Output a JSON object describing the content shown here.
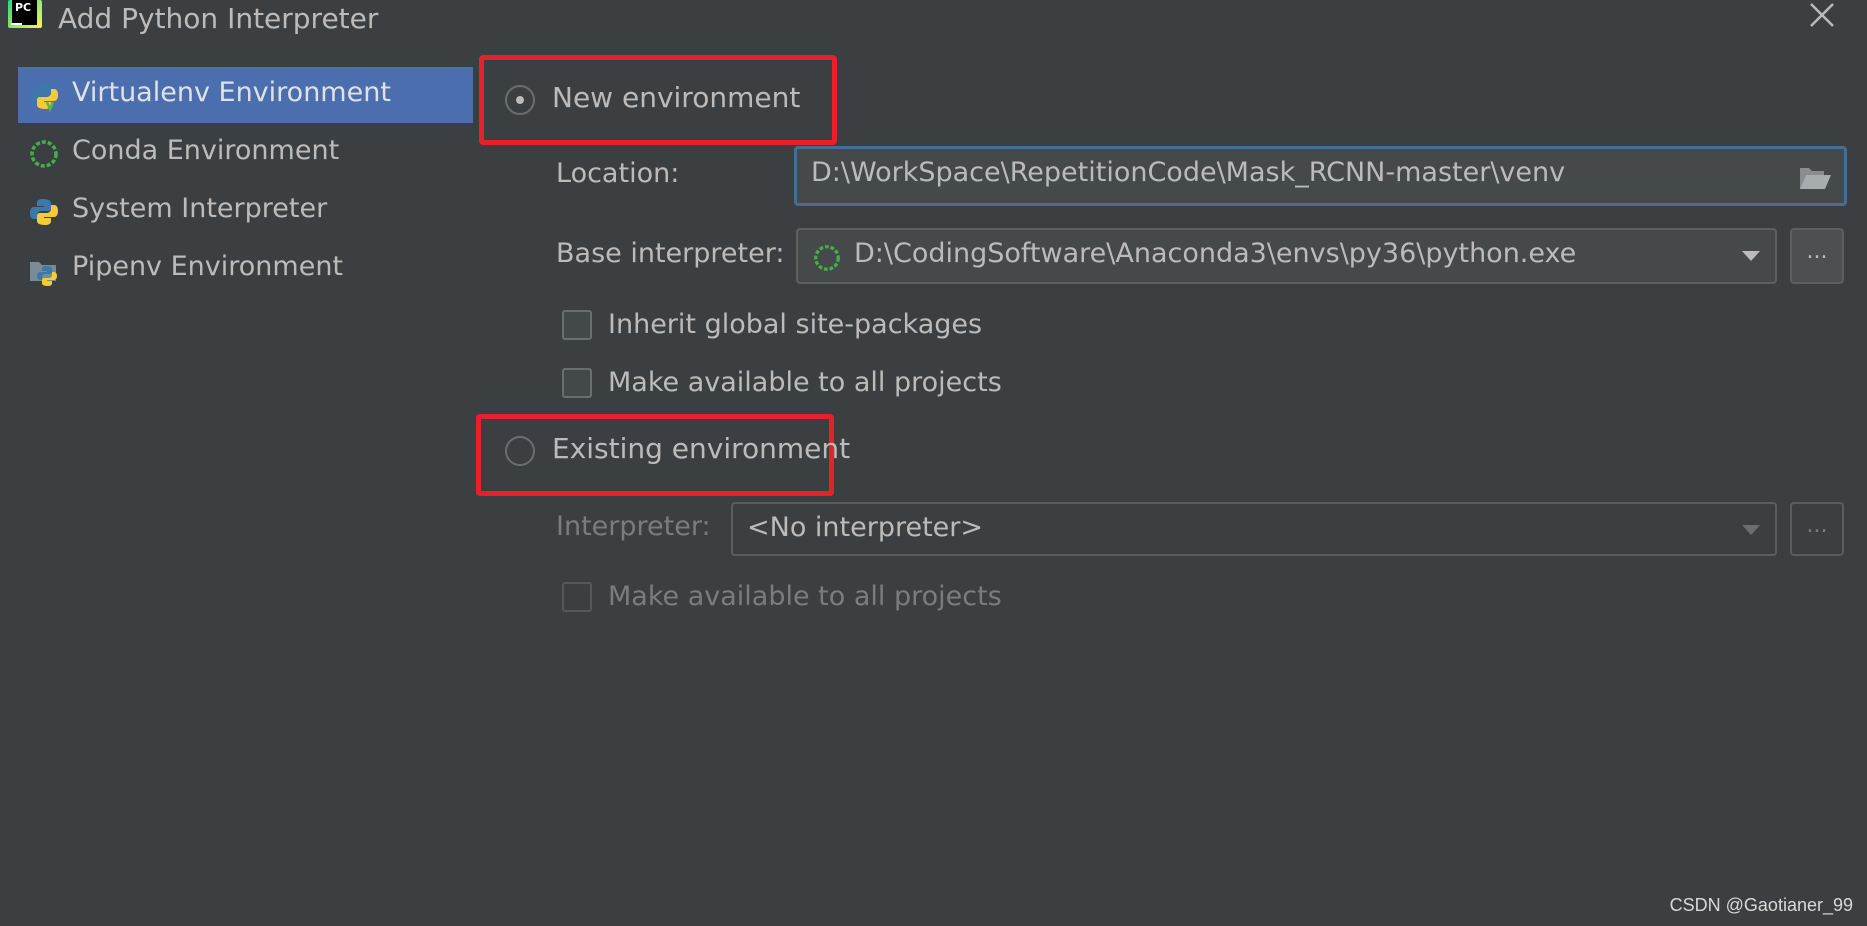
{
  "window": {
    "app_logo_text": "PC",
    "title": "Add Python Interpreter"
  },
  "sidebar": {
    "items": [
      {
        "label": "Virtualenv Environment",
        "icon": "python-venv-icon",
        "selected": true
      },
      {
        "label": "Conda Environment",
        "icon": "conda-icon",
        "selected": false
      },
      {
        "label": "System Interpreter",
        "icon": "python-icon",
        "selected": false
      },
      {
        "label": "Pipenv Environment",
        "icon": "pipenv-icon",
        "selected": false
      }
    ]
  },
  "new_env": {
    "label": "New environment",
    "selected": true,
    "location_label": "Location:",
    "location_value": "D:\\WorkSpace\\RepetitionCode\\Mask_RCNN-master\\venv",
    "base_label": "Base interpreter:",
    "base_value": "D:\\CodingSoftware\\Anaconda3\\envs\\py36\\python.exe",
    "browse_label": "...",
    "inherit_label": "Inherit global site-packages",
    "available_label": "Make available to all projects"
  },
  "existing_env": {
    "label": "Existing environment",
    "selected": false,
    "interpreter_label": "Interpreter:",
    "interpreter_value": "<No interpreter>",
    "browse_label": "...",
    "available_label": "Make available to all projects"
  },
  "watermark": "CSDN @Gaotianer_99",
  "colors": {
    "background": "#3c3f41",
    "selection": "#4b6eaf",
    "highlight_red": "#e8202a",
    "focus_border": "#466d94"
  }
}
